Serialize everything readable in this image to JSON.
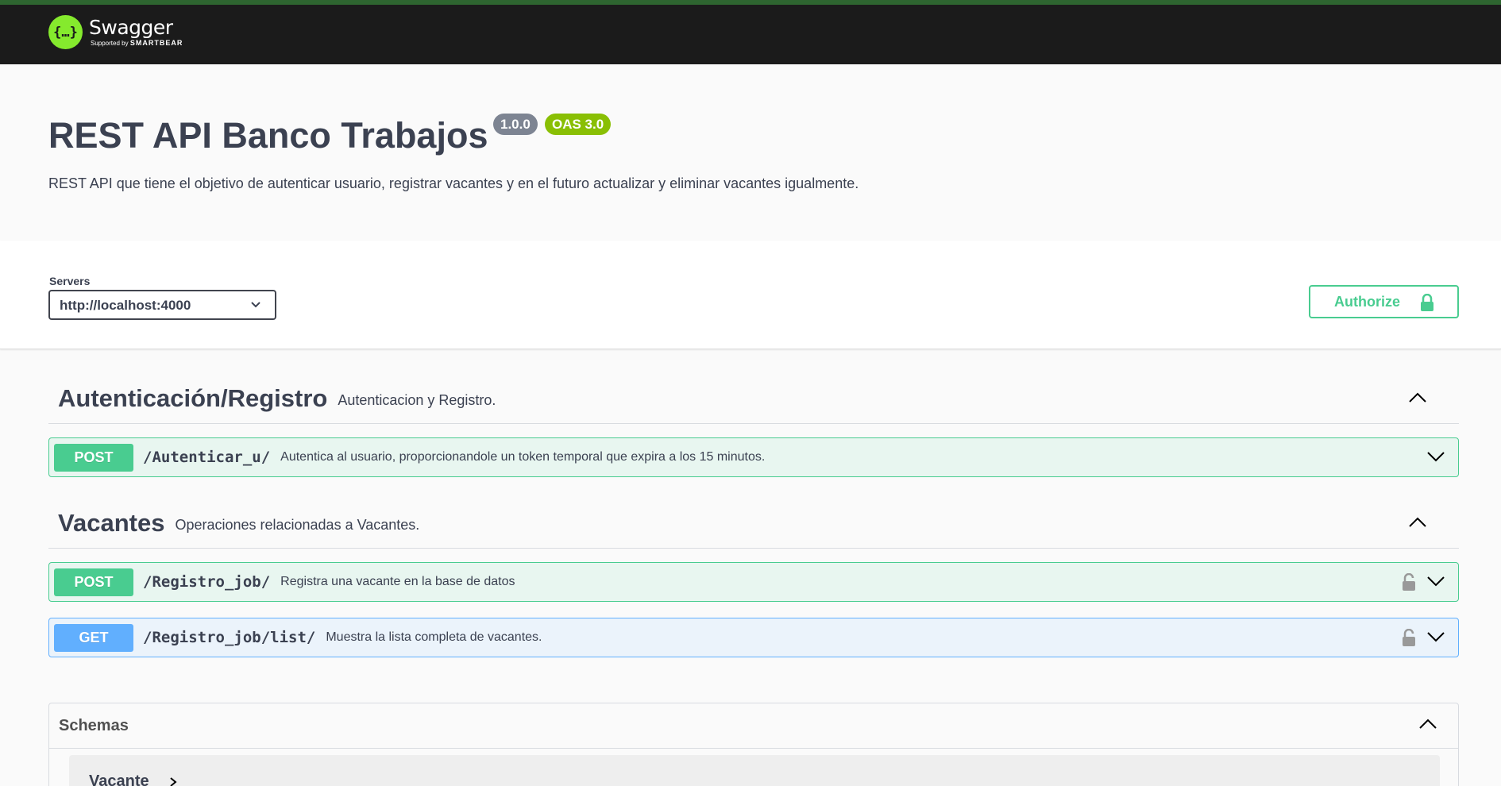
{
  "topbar": {
    "logo_name": "Swagger",
    "logo_sub_prefix": "Supported by",
    "logo_sub_brand": "SMARTBEAR",
    "logo_glyph": "{…}"
  },
  "info": {
    "title": "REST API Banco Trabajos",
    "version": "1.0.0",
    "oas": "OAS 3.0",
    "description": "REST API que tiene el objetivo de autenticar usuario, registrar vacantes y en el futuro actualizar y eliminar vacantes igualmente."
  },
  "servers": {
    "label": "Servers",
    "selected": "http://localhost:4000"
  },
  "authorize": {
    "label": "Authorize"
  },
  "tags": [
    {
      "name": "Autenticación/Registro",
      "description": "Autenticacion y Registro.",
      "operations": [
        {
          "method": "POST",
          "path": "/Autenticar_u/",
          "summary": "Autentica al usuario, proporcionandole un token temporal que expira a los 15 minutos."
        }
      ]
    },
    {
      "name": "Vacantes",
      "description": "Operaciones relacionadas a Vacantes.",
      "operations": [
        {
          "method": "POST",
          "path": "/Registro_job/",
          "summary": "Registra una vacante en la base de datos"
        },
        {
          "method": "GET",
          "path": "/Registro_job/list/",
          "summary": "Muestra la lista completa de vacantes."
        }
      ]
    }
  ],
  "schemas": {
    "title": "Schemas",
    "items": [
      "Vacante"
    ]
  },
  "colors": {
    "post": "#49cc90",
    "get": "#61affe",
    "topbar": "#1b1b1b",
    "logo": "#85ea2d"
  }
}
